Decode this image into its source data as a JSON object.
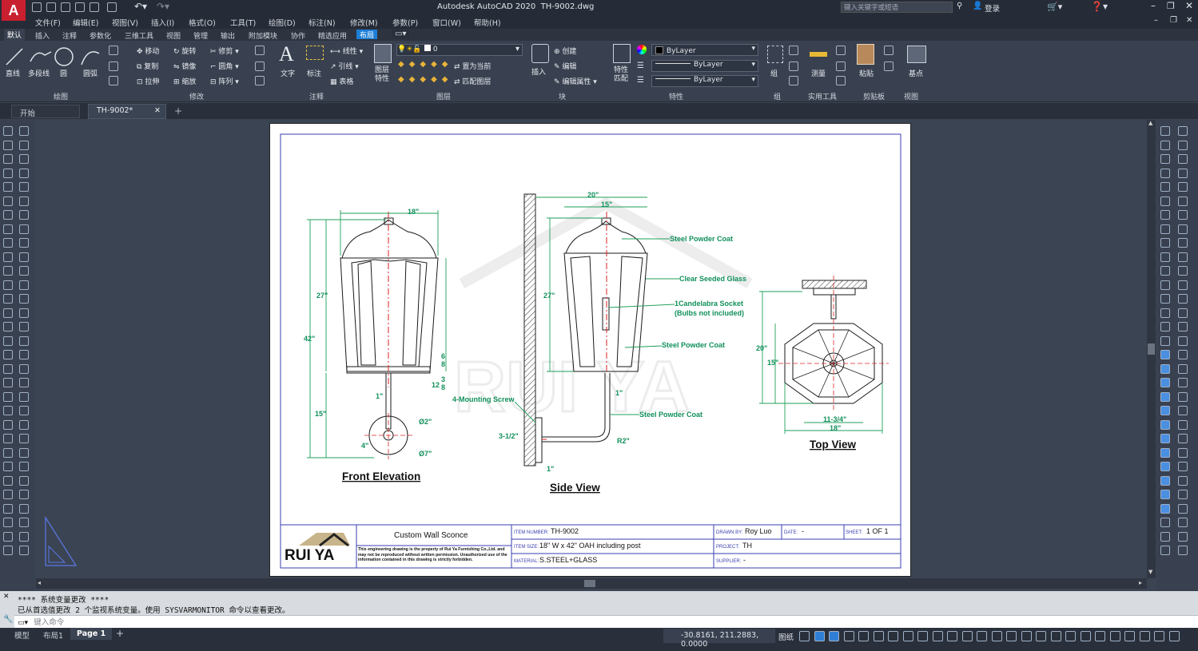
{
  "app": {
    "title": "Autodesk AutoCAD 2020",
    "file": "TH-9002.dwg",
    "search_placeholder": "键入关键字或短语",
    "login": "登录"
  },
  "menus": [
    "文件(F)",
    "编辑(E)",
    "视图(V)",
    "插入(I)",
    "格式(O)",
    "工具(T)",
    "绘图(D)",
    "标注(N)",
    "修改(M)",
    "参数(P)",
    "窗口(W)",
    "帮助(H)"
  ],
  "ribbon_tabs": [
    "默认",
    "插入",
    "注释",
    "参数化",
    "三维工具",
    "视图",
    "管理",
    "输出",
    "附加模块",
    "协作",
    "精选应用",
    "布局"
  ],
  "ribbon": {
    "draw": [
      "直线",
      "多段线",
      "圆",
      "圆弧"
    ],
    "modify": [
      "移动",
      "旋转",
      "修剪",
      "复制",
      "镜像",
      "圆角",
      "拉伸",
      "缩放",
      "阵列"
    ],
    "text": "文字",
    "dimension": "标注",
    "linear": "线性",
    "leader": "引线",
    "table": "表格",
    "layer_props": "图层\n特性",
    "layer_value": "0",
    "set_current": "置为当前",
    "match_layer": "匹配图层",
    "insert": "插入",
    "create": "创建",
    "edit": "编辑",
    "edit_attr": "编辑属性",
    "match_props": "特性\n匹配",
    "bylayer": "ByLayer",
    "group": "组",
    "measure": "测量",
    "paste": "粘贴",
    "base": "基点",
    "groups": [
      "绘图",
      "修改",
      "注释",
      "图层",
      "块",
      "特性",
      "组",
      "实用工具",
      "剪贴板",
      "视图"
    ]
  },
  "doc_tabs": [
    "开始",
    "TH-9002*"
  ],
  "drawing": {
    "front_title": "Front Elevation",
    "side_title": "Side View",
    "top_title": "Top View",
    "dims_front": {
      "w": "18\"",
      "h_total": "42\"",
      "h_body": "27\"",
      "h_bottom": "15\"",
      "d1": "1\"",
      "d2": "4\"",
      "d3": "Ø2\"",
      "d4": "Ø7\"",
      "f1": "6",
      "f1d": "8",
      "f2": "12",
      "f2n": "3",
      "f2d": "8"
    },
    "dims_side": {
      "w1": "20\"",
      "w2": "15\"",
      "h": "27\"",
      "d1": "1\"",
      "d2": "3-1/2\"",
      "d3": "1\"",
      "r": "R2\""
    },
    "callouts": [
      "Steel Powder Coat",
      "Clear Seeded Glass",
      "1Candelabra Socket",
      "(Bulbs not included)",
      "Steel Powder Coat",
      "4-Mounting Screw",
      "Steel Powder Coat"
    ],
    "dims_top": {
      "h1": "20\"",
      "h2": "15\"",
      "w1": "11-3/4\"",
      "w2": "18\""
    }
  },
  "titleblock": {
    "logo": "RUI YA",
    "product": "Custom Wall Sconce",
    "notice": "This engineering drawing is the property of Rui Ya Furnishing Co.,Ltd. and may not be reproduced without written permission. Unauthorized use of the information contained in this drawing is strictly forbidden.",
    "item_number_label": "ITEM NUMBER:",
    "item_number": "TH-9002",
    "item_size_label": "ITEM SIZE:",
    "item_size": "18\" W x 42\" OAH including post",
    "material_label": "MATERIAL:",
    "material": "S.STEEL+GLASS",
    "drawn_label": "DRAWN BY:",
    "drawn": "Roy Luo",
    "date_label": "DATE:",
    "date": "-",
    "sheet_label": "SHEET:",
    "sheet": "1 OF 1",
    "project_label": "PROJECT:",
    "project": "TH",
    "supplier_label": "SUPPLIER:",
    "supplier": "-"
  },
  "command": {
    "line1": "**** 系统变量更改 ****",
    "line2": "已从首选值更改 2 个监视系统变量。使用 SYSVARMONITOR 命令以查看更改。",
    "placeholder": "键入命令"
  },
  "layout_tabs": [
    "模型",
    "布局1",
    "Page 1"
  ],
  "status": {
    "coords": "-30.8161, 211.2883, 0.0000",
    "paper": "图纸"
  }
}
